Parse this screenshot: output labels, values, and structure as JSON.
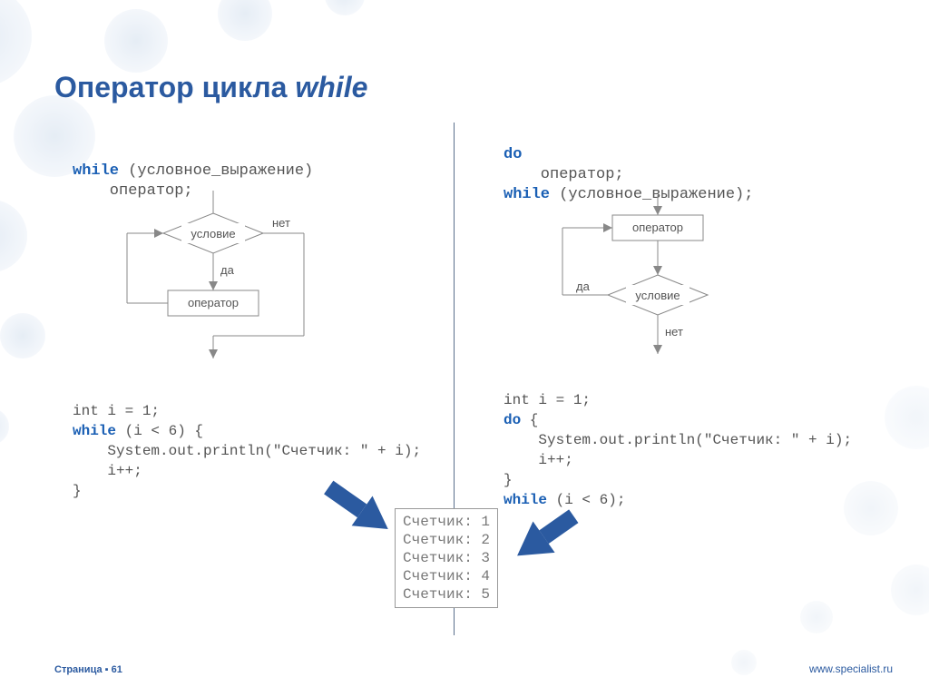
{
  "title_main": "Оператор цикла ",
  "title_italic": "while",
  "left_syntax": {
    "kw": "while",
    "cond": " (условное_выражение)",
    "body": "    оператор;"
  },
  "right_syntax": {
    "kw_do": "do",
    "body": "    оператор;",
    "kw_while": "while",
    "cond": " (условное_выражение);"
  },
  "flowchart_left": {
    "condition": "условие",
    "operator": "оператор",
    "yes": "да",
    "no": "нет"
  },
  "flowchart_right": {
    "condition": "условие",
    "operator": "оператор",
    "yes": "да",
    "no": "нет"
  },
  "example_left": {
    "l1": "int i = 1;",
    "l2_kw": "while",
    "l2_rest": " (i < 6) {",
    "l3": "    System.out.println(\"Счетчик: \" + i);",
    "l4": "    i++;",
    "l5": "}"
  },
  "example_right": {
    "l1": "int i = 1;",
    "l2_kw": "do",
    "l2_rest": " {",
    "l3": "    System.out.println(\"Счетчик: \" + i);",
    "l4": "    i++;",
    "l5": "}",
    "l6_kw": "while",
    "l6_rest": " (i < 6);"
  },
  "output": [
    "Счетчик: 1",
    "Счетчик: 2",
    "Счетчик: 3",
    "Счетчик: 4",
    "Счетчик: 5"
  ],
  "footer": {
    "page_label": "Страница",
    "page_num": "61",
    "url": "www.specialist.ru"
  }
}
